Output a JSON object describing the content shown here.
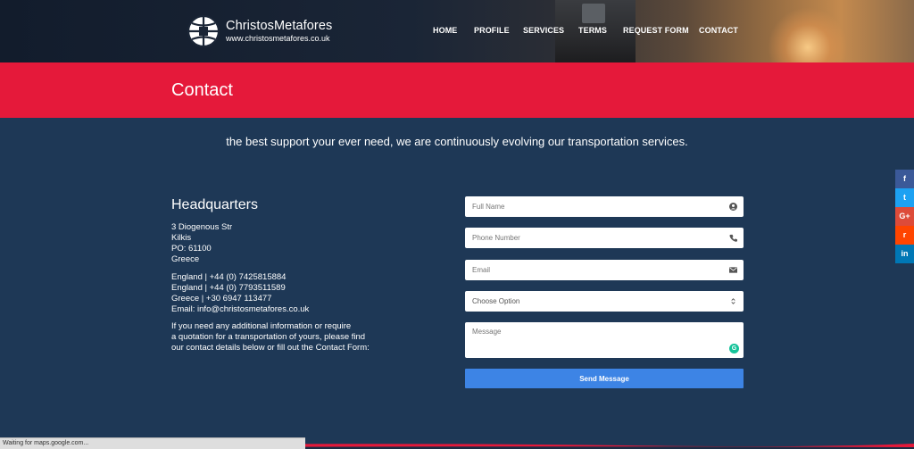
{
  "header": {
    "brand": "ChristosMetafores",
    "url": "www.christosmetafores.co.uk",
    "nav": [
      "HOME",
      "PROFILE",
      "SERVICES",
      "TERMS",
      "REQUEST FORM",
      "CONTACT"
    ]
  },
  "page": {
    "title": "Contact"
  },
  "tagline": "the best support your ever need, we are continuously evolving our transportation services.",
  "hq": {
    "title": "Headquarters",
    "address": [
      "3 Diogenous Str",
      "Kilkis",
      "PO: 61100",
      "Greece"
    ],
    "contacts": [
      "England | +44 (0) 7425815884",
      "England | +44 (0) 7793511589",
      "Greece | +30 6947 113477",
      "Email: info@christosmetafores.co.uk"
    ],
    "info": [
      "If you need any additional information or require",
      "a quotation for a transportation of yours, please find",
      "our contact details below or fill out the Contact Form:"
    ]
  },
  "form": {
    "full_name_placeholder": "Full Name",
    "phone_placeholder": "Phone Number",
    "email_placeholder": "Email",
    "choose_option": "Choose Option",
    "message_placeholder": "Message",
    "send_label": "Send Message"
  },
  "social": {
    "items": [
      {
        "name": "facebook",
        "glyph": "f",
        "color": "#3b5998"
      },
      {
        "name": "twitter",
        "glyph": "t",
        "color": "#1da1f2"
      },
      {
        "name": "google-plus",
        "glyph": "G+",
        "color": "#dd4b39"
      },
      {
        "name": "reddit",
        "glyph": "r",
        "color": "#ff4500"
      },
      {
        "name": "linkedin",
        "glyph": "in",
        "color": "#0077b5"
      }
    ]
  },
  "status": "Waiting for maps.google.com...",
  "colors": {
    "banner": "#e5193a",
    "background": "#1e3856",
    "button": "#3d84e5"
  }
}
